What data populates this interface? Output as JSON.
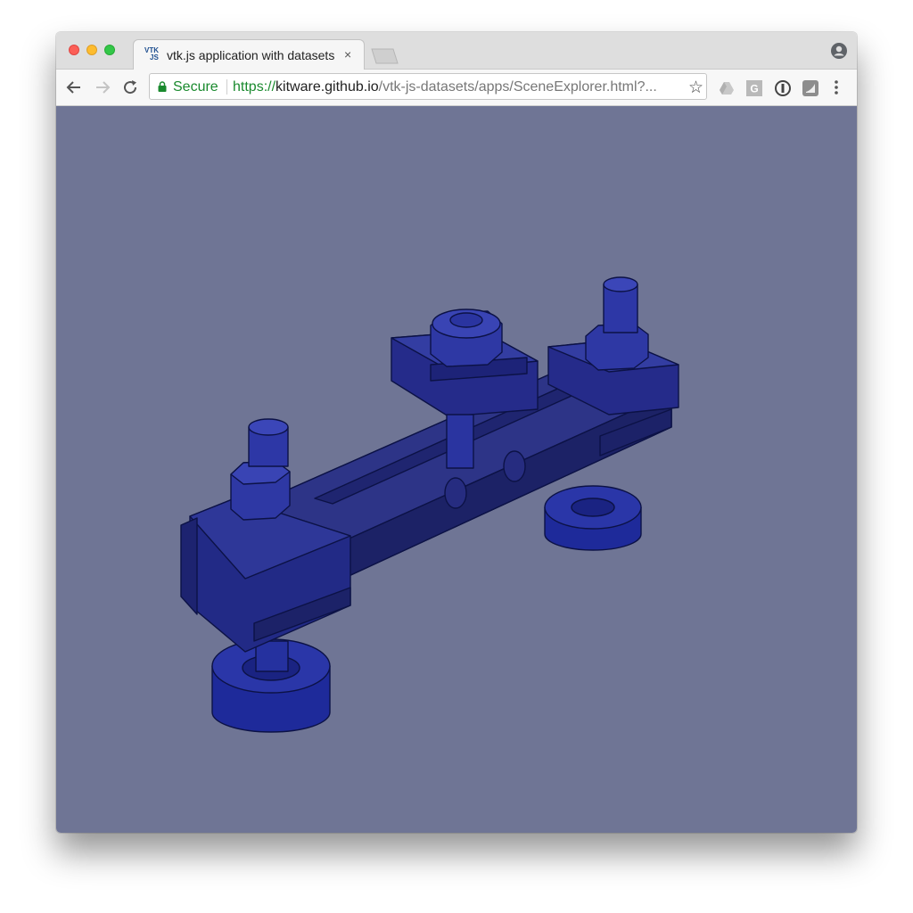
{
  "window": {
    "traffic_lights": [
      "close",
      "minimize",
      "maximize"
    ]
  },
  "tab": {
    "favicon_text_top": "VTK",
    "favicon_text_bottom": "JS",
    "title": "vtk.js application with datasets",
    "close_glyph": "×"
  },
  "toolbar": {
    "back_icon": "arrow-left-icon",
    "forward_icon": "arrow-right-icon",
    "reload_icon": "reload-icon",
    "security_label": "Secure",
    "url": {
      "scheme": "https://",
      "host": "kitware.github.io",
      "path": "/vtk-js-datasets/apps/SceneExplorer.html?..."
    },
    "bookmark_icon": "star-icon",
    "extensions": [
      "google-drive-icon",
      "grammarly-icon",
      "1password-icon",
      "extension-icon"
    ],
    "menu_icon": "kebab-menu-icon"
  },
  "viewport": {
    "background_color": "#6f7595",
    "model_color": "#1f2a8f",
    "content": "3D render of a clamp assembly with bolts, nuts and cylindrical feet"
  },
  "colors": {
    "secure_green": "#1a8a2e",
    "tabstrip": "#dedede",
    "toolbar": "#f7f7f7"
  }
}
